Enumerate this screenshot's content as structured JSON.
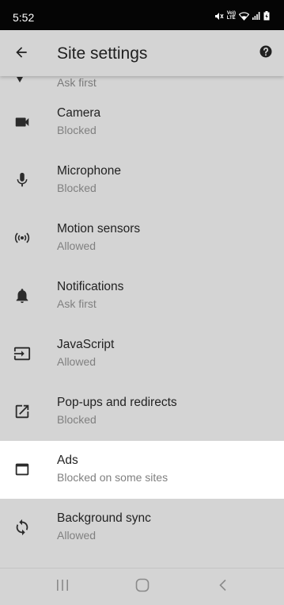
{
  "status_bar": {
    "time": "5:52",
    "icons": [
      "mute-icon",
      "volte-icon",
      "wifi-icon",
      "signal-icon",
      "battery-charging-icon"
    ],
    "network_label_top": "Vo))",
    "network_label_bottom": "LTE"
  },
  "toolbar": {
    "title": "Site settings",
    "back_icon": "arrow-back-icon",
    "help_icon": "help-icon"
  },
  "partial_item": {
    "subtitle": "Ask first"
  },
  "settings": [
    {
      "label": "Camera",
      "status": "Blocked",
      "icon": "camera-icon"
    },
    {
      "label": "Microphone",
      "status": "Blocked",
      "icon": "microphone-icon"
    },
    {
      "label": "Motion sensors",
      "status": "Allowed",
      "icon": "motion-sensors-icon"
    },
    {
      "label": "Notifications",
      "status": "Ask first",
      "icon": "bell-icon"
    },
    {
      "label": "JavaScript",
      "status": "Allowed",
      "icon": "javascript-icon"
    },
    {
      "label": "Pop-ups and redirects",
      "status": "Blocked",
      "icon": "popup-icon"
    },
    {
      "label": "Ads",
      "status": "Blocked on some sites",
      "icon": "ads-icon",
      "highlighted": true
    },
    {
      "label": "Background sync",
      "status": "Allowed",
      "icon": "sync-icon"
    }
  ],
  "nav_bar": {
    "buttons": [
      "recents-icon",
      "home-icon",
      "back-icon"
    ]
  },
  "colors": {
    "background": "#d4d4d4",
    "highlight": "#ffffff",
    "icon": "#2b2b2b",
    "status_bar": "#050505"
  }
}
